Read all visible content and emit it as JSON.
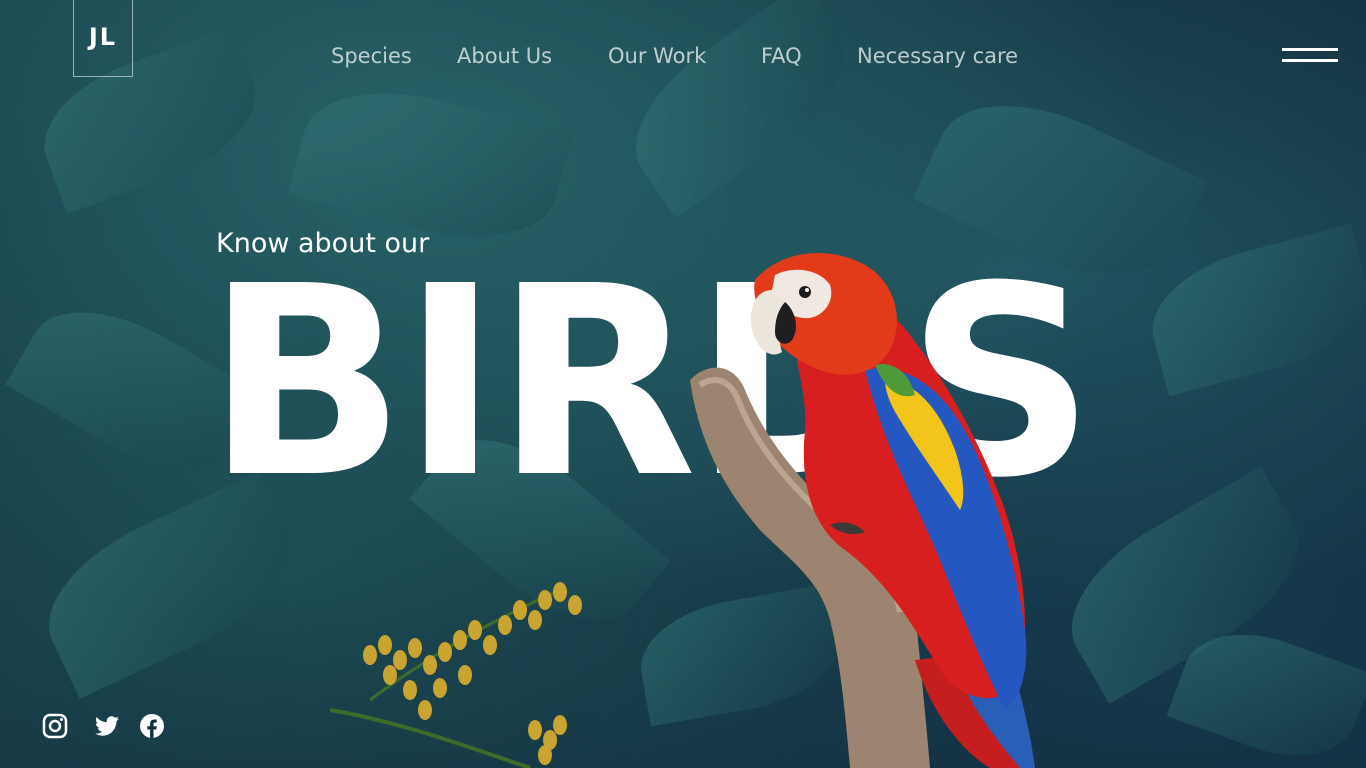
{
  "header": {
    "logo_text": "JL",
    "nav": [
      {
        "label": "Species"
      },
      {
        "label": "About Us"
      },
      {
        "label": "Our Work"
      },
      {
        "label": "FAQ"
      },
      {
        "label": "Necessary care"
      }
    ],
    "menu_icon": "hamburger-menu-icon"
  },
  "hero": {
    "kicker": "Know about our",
    "headline": "BIRDS",
    "image": "scarlet-macaw-on-branch"
  },
  "social": [
    {
      "icon": "instagram-icon"
    },
    {
      "icon": "twitter-icon"
    },
    {
      "icon": "facebook-icon"
    }
  ],
  "colors": {
    "background": "#12303f",
    "foliage": "#2e6f73",
    "text": "#ffffff",
    "nav_text": "#d9e2e2"
  }
}
